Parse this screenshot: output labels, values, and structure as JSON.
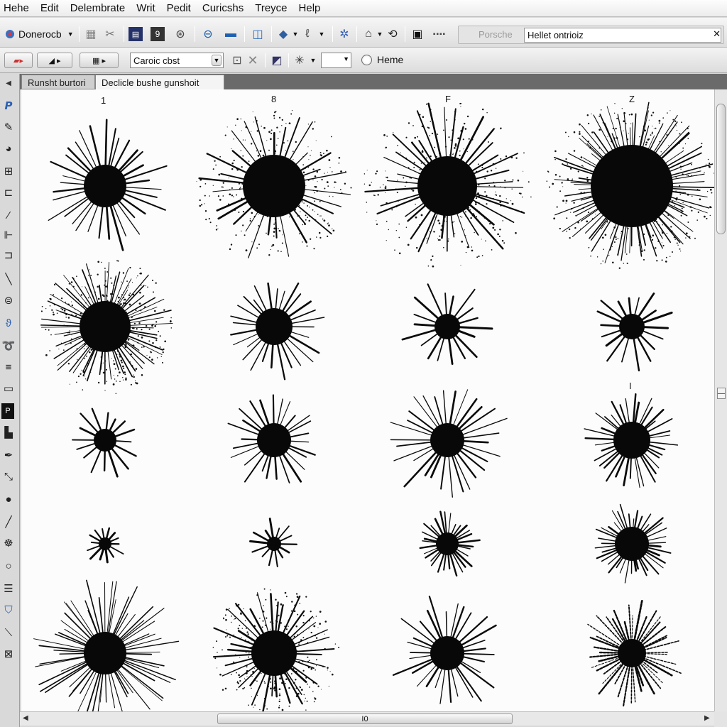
{
  "menu": [
    "Hehe",
    "Edit",
    "Delembrate",
    "Writ",
    "Pedit",
    "Curicshs",
    "Treyce",
    "Help"
  ],
  "toolbar": {
    "document_dropdown": "Donerocb",
    "search_placeholder": "Porsche",
    "search_value": "Hellet ontrioiz",
    "search_clear": "✕"
  },
  "toolbar2": {
    "font_select": "Caroic cbst",
    "radio_label": "Heme"
  },
  "tabs": [
    "Runsht burtori",
    "Declicle bushe gunshoit"
  ],
  "columns": [
    "1",
    "8",
    "F",
    "Z"
  ],
  "extra_label": "I",
  "hscroll_label": "I0",
  "brushes": [
    {
      "col": 0,
      "row": 0,
      "style": "spiky",
      "r": 96,
      "core": 30,
      "rays": 34,
      "spray": false
    },
    {
      "col": 1,
      "row": 0,
      "style": "spray",
      "r": 110,
      "core": 44,
      "rays": 30,
      "spray": true
    },
    {
      "col": 2,
      "row": 0,
      "style": "spray",
      "r": 120,
      "core": 42,
      "rays": 38,
      "spray": true
    },
    {
      "col": 3,
      "row": 0,
      "style": "dense",
      "r": 120,
      "core": 58,
      "rays": 90,
      "spray": true
    },
    {
      "col": 0,
      "row": 1,
      "style": "dense",
      "r": 96,
      "core": 36,
      "rays": 60,
      "spray": true
    },
    {
      "col": 1,
      "row": 1,
      "style": "spiky",
      "r": 76,
      "core": 26,
      "rays": 28,
      "spray": false
    },
    {
      "col": 2,
      "row": 1,
      "style": "star",
      "r": 66,
      "core": 18,
      "rays": 18,
      "spray": false
    },
    {
      "col": 3,
      "row": 1,
      "style": "star",
      "r": 66,
      "core": 18,
      "rays": 18,
      "spray": false
    },
    {
      "col": 0,
      "row": 2,
      "style": "star",
      "r": 54,
      "core": 16,
      "rays": 16,
      "spray": false
    },
    {
      "col": 1,
      "row": 2,
      "style": "spiky",
      "r": 74,
      "core": 24,
      "rays": 26,
      "spray": false
    },
    {
      "col": 2,
      "row": 2,
      "style": "spiky",
      "r": 90,
      "core": 24,
      "rays": 30,
      "spray": false
    },
    {
      "col": 3,
      "row": 2,
      "style": "spiky",
      "r": 70,
      "core": 26,
      "rays": 36,
      "spray": false
    },
    {
      "col": 0,
      "row": 3,
      "style": "star",
      "r": 30,
      "core": 9,
      "rays": 14,
      "spray": false
    },
    {
      "col": 1,
      "row": 3,
      "style": "star",
      "r": 36,
      "core": 10,
      "rays": 14,
      "spray": false
    },
    {
      "col": 2,
      "row": 3,
      "style": "spiky",
      "r": 48,
      "core": 16,
      "rays": 30,
      "spray": false
    },
    {
      "col": 3,
      "row": 3,
      "style": "spiky",
      "r": 58,
      "core": 24,
      "rays": 40,
      "spray": false
    },
    {
      "col": 0,
      "row": 4,
      "style": "dense",
      "r": 106,
      "core": 30,
      "rays": 64,
      "spray": false
    },
    {
      "col": 1,
      "row": 4,
      "style": "spray",
      "r": 92,
      "core": 32,
      "rays": 36,
      "spray": true
    },
    {
      "col": 2,
      "row": 4,
      "style": "spiky",
      "r": 84,
      "core": 24,
      "rays": 30,
      "spray": false
    },
    {
      "col": 3,
      "row": 4,
      "style": "dashed",
      "r": 76,
      "core": 20,
      "rays": 44,
      "spray": false
    }
  ]
}
